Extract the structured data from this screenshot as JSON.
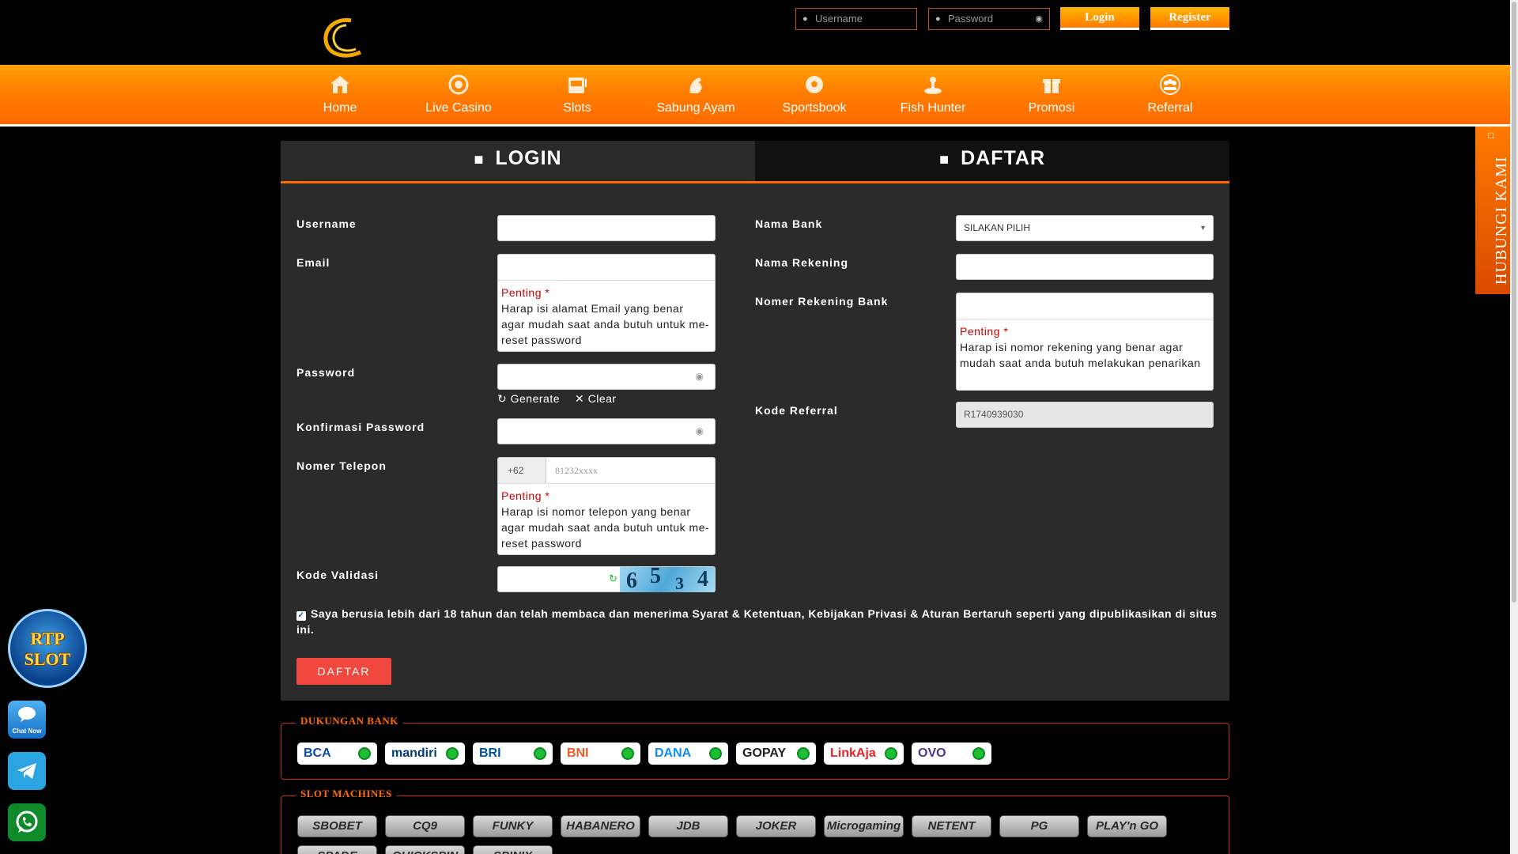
{
  "header": {
    "username_placeholder": "Username",
    "password_placeholder": "Password",
    "login_label": "Login",
    "register_label": "Register"
  },
  "nav": {
    "items": [
      {
        "label": "Home",
        "icon": "home-icon"
      },
      {
        "label": "Live Casino",
        "icon": "roulette-icon"
      },
      {
        "label": "Slots",
        "icon": "slot-machine-icon"
      },
      {
        "label": "Sabung Ayam",
        "icon": "rooster-icon"
      },
      {
        "label": "Sportsbook",
        "icon": "soccer-ball-icon"
      },
      {
        "label": "Fish Hunter",
        "icon": "fish-icon"
      },
      {
        "label": "Promosi",
        "icon": "gift-icon"
      },
      {
        "label": "Referral",
        "icon": "group-icon"
      }
    ]
  },
  "tabs": {
    "login": "LOGIN",
    "daftar": "DAFTAR"
  },
  "form": {
    "username_label": "Username",
    "email_label": "Email",
    "penting": "Penting *",
    "email_note": "Harap isi alamat Email yang benar agar mudah saat anda butuh untuk me-reset password",
    "password_label": "Password",
    "generate": "Generate",
    "clear": "Clear",
    "confirm_password_label": "Konfirmasi Password",
    "phone_label": "Nomer Telepon",
    "phone_prefix": "+62",
    "phone_placeholder": "81232xxxx",
    "phone_note": "Harap isi nomor telepon yang benar agar mudah saat anda butuh untuk me-reset password",
    "captcha_label": "Kode Validasi",
    "captcha_digits": [
      "6",
      "5",
      "3",
      "4"
    ],
    "bank_label": "Nama Bank",
    "bank_selected": "SILAKAN PILIH",
    "account_name_label": "Nama Rekening",
    "account_number_label": "Nomer Rekening Bank",
    "account_note": "Harap isi nomor rekening yang benar agar mudah saat anda butuh melakukan penarikan",
    "referral_label": "Kode Referral",
    "referral_value": "R1740939030",
    "agree_text": "Saya berusia lebih dari 18 tahun dan telah membaca dan menerima Syarat & Ketentuan, Kebijakan Privasi & Aturan Bertaruh seperti yang dipublikasikan di situs ini.",
    "agree_checked": true,
    "submit_label": "DAFTAR"
  },
  "banks": {
    "legend": "DUKUNGAN BANK",
    "items": [
      {
        "name": "BCA",
        "color": "#0b4ea2"
      },
      {
        "name": "mandiri",
        "color": "#003d79"
      },
      {
        "name": "BRI",
        "color": "#00529c"
      },
      {
        "name": "BNI",
        "color": "#f15a23"
      },
      {
        "name": "DANA",
        "color": "#118eea"
      },
      {
        "name": "GOPAY",
        "color": "#222222"
      },
      {
        "name": "LinkAja",
        "color": "#e82429"
      },
      {
        "name": "OVO",
        "color": "#4c3494"
      }
    ]
  },
  "slots": {
    "legend": "SLOT MACHINES",
    "items": [
      "SBOBET",
      "CQ9",
      "FUNKY GAMES",
      "HABANERO",
      "JDB",
      "JOKER",
      "Microgaming",
      "NETENT",
      "PG",
      "PLAY'n GO",
      "SPADE",
      "QUICKSPIN",
      "SPINIX"
    ]
  },
  "side": {
    "contact_label": "HUBUNGI KAMI",
    "rtp_line1": "RTP",
    "rtp_line2": "SLOT",
    "chat_now": "Chat Now"
  },
  "colors": {
    "accent": "#ff7a00",
    "danger": "#f0483e",
    "panel": "#2b2b2b"
  }
}
